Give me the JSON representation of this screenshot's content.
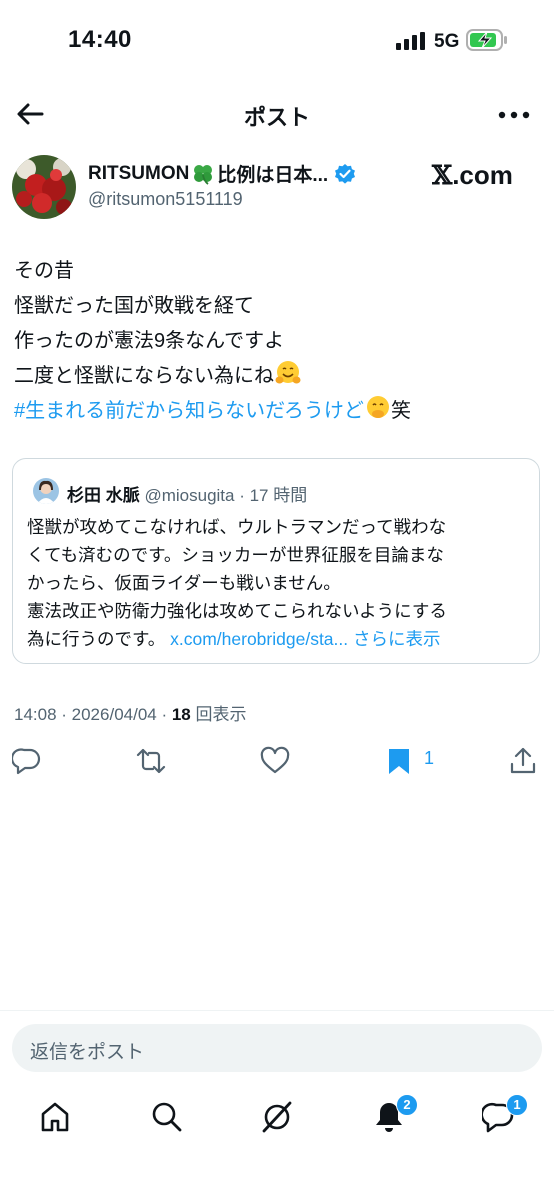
{
  "status_bar": {
    "time": "14:40",
    "network": "5G"
  },
  "header": {
    "title": "ポスト",
    "back_icon": "arrow-left-icon",
    "more_icon": "more-horizontal-icon"
  },
  "author": {
    "display_name_prefix": "RITSUMON",
    "display_name_suffix": "比例は日本...",
    "handle": "@ritsumon5151119",
    "verified": true,
    "source_badge_x": "𝕏",
    "source_badge_rest": ".com"
  },
  "post": {
    "lines": [
      "その昔",
      "怪獣だった国が敗戦を経て",
      "作ったのが憲法9条なんですよ",
      "二度と怪獣にならない為にね"
    ],
    "hashtag": "#生まれる前だから知らないだろうけど",
    "hashtag_suffix": "笑"
  },
  "quote": {
    "name": "杉田 水脈",
    "handle": "@miosugita",
    "time": "· 17 時間",
    "lines": [
      "怪獣が攻めてこなければ、ウルトラマンだって戦わな",
      "くても済むのです。ショッカーが世界征服を目論まな",
      "かったら、仮面ライダーも戦いません。",
      "憲法改正や防衛力強化は攻めてこられないようにする"
    ],
    "last_line": "為に行うのです。",
    "link": "x.com/herobridge/sta...",
    "show_more": "さらに表示"
  },
  "meta": {
    "time": "14:08 · 2026/04/04 · ",
    "views_count": "18",
    "views_label": " 回表示"
  },
  "actions": {
    "bookmark_count": "1"
  },
  "reply": {
    "placeholder": "返信をポスト"
  },
  "tabs": {
    "notifications_badge": "2",
    "messages_badge": "1"
  },
  "colors": {
    "accent": "#1d9bf0",
    "text": "#0f1419",
    "muted": "#536471",
    "border": "#cfd9de"
  }
}
